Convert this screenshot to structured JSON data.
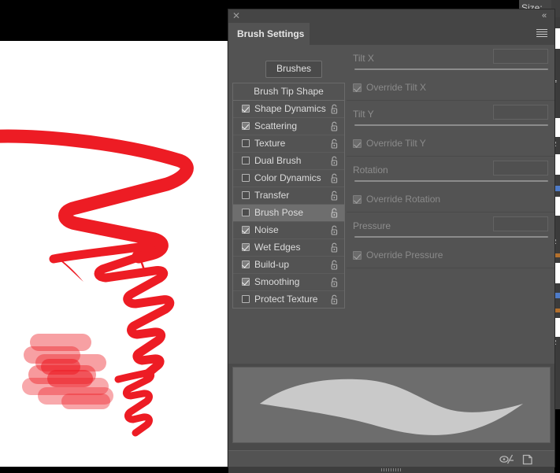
{
  "window": {
    "title": "Brush Settings",
    "close_icon": "close-icon",
    "collapse_icon": "collapse-double-chevron-icon",
    "menu_icon": "panel-menu-icon"
  },
  "background": {
    "size_label_peek": "Size:",
    "canvas_background": "#ffffff",
    "outer_background": "#000000"
  },
  "tabs": [
    {
      "label": "Brush Settings",
      "active": true
    }
  ],
  "toolbar": {
    "brushes_button_label": "Brushes"
  },
  "brush_options": {
    "header_label": "Brush Tip Shape",
    "items": [
      {
        "label": "Shape Dynamics",
        "checked": true,
        "selected": false,
        "locked": false
      },
      {
        "label": "Scattering",
        "checked": true,
        "selected": false,
        "locked": false
      },
      {
        "label": "Texture",
        "checked": false,
        "selected": false,
        "locked": false
      },
      {
        "label": "Dual Brush",
        "checked": false,
        "selected": false,
        "locked": false
      },
      {
        "label": "Color Dynamics",
        "checked": false,
        "selected": false,
        "locked": false
      },
      {
        "label": "Transfer",
        "checked": false,
        "selected": false,
        "locked": false
      },
      {
        "label": "Brush Pose",
        "checked": false,
        "selected": true,
        "locked": false
      },
      {
        "label": "Noise",
        "checked": true,
        "selected": false,
        "locked": false
      },
      {
        "label": "Wet Edges",
        "checked": true,
        "selected": false,
        "locked": false
      },
      {
        "label": "Build-up",
        "checked": true,
        "selected": false,
        "locked": false
      },
      {
        "label": "Smoothing",
        "checked": true,
        "selected": false,
        "locked": false
      },
      {
        "label": "Protect Texture",
        "checked": false,
        "selected": false,
        "locked": false
      }
    ]
  },
  "brush_pose_controls": {
    "disabled": true,
    "groups": [
      {
        "slider_label": "Tilt X",
        "slider_value": "",
        "override_label": "Override Tilt X",
        "override_checked": true
      },
      {
        "slider_label": "Tilt Y",
        "slider_value": "",
        "override_label": "Override Tilt Y",
        "override_checked": true
      },
      {
        "slider_label": "Rotation",
        "slider_value": "",
        "override_label": "Override Rotation",
        "override_checked": true
      },
      {
        "slider_label": "Pressure",
        "slider_value": "",
        "override_label": "Override Pressure",
        "override_checked": true
      }
    ]
  },
  "preview": {
    "stroke_color": "#c9c9c9",
    "background_color": "#6d6d6d"
  },
  "footer": {
    "icons": [
      {
        "name": "new-brush-preset-icon"
      },
      {
        "name": "create-new-brush-icon"
      }
    ]
  },
  "artwork": {
    "stroke_color": "#ed1c24",
    "blob_color": "rgba(237,28,36,0.45)",
    "description": "red zigzag brush strokes and semi-transparent dabs on white canvas"
  },
  "colors": {
    "panel_background": "#535353",
    "panel_header": "#454545",
    "text_primary": "#dcdcdc",
    "text_disabled": "#8a8a8a",
    "accent_red": "#ed1c24"
  }
}
